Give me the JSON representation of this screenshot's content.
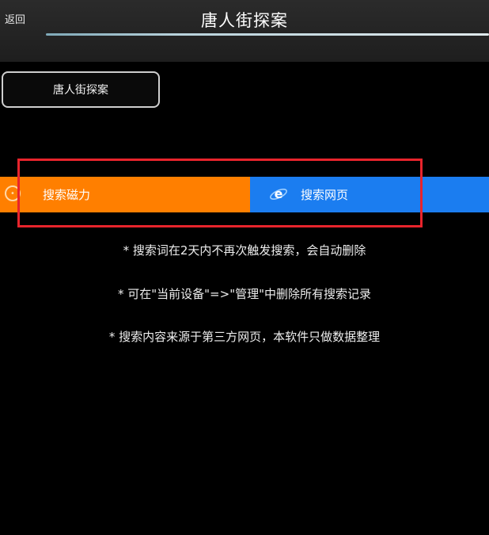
{
  "header": {
    "back_label": "返回",
    "title": "唐人街探案"
  },
  "search": {
    "keyword": "唐人街探案"
  },
  "tabs": [
    {
      "label": "搜索磁力",
      "color": "#ff7f00"
    },
    {
      "label": "搜索网页",
      "color": "#1b7df0"
    }
  ],
  "notes": [
    "* 搜索词在2天内不再次触发搜索，会自动删除",
    "* 可在\"当前设备\"=>\"管理\"中删除所有搜索记录",
    "* 搜索内容来源于第三方网页，本软件只做数据整理"
  ],
  "colors": {
    "background": "#000000",
    "highlight": "#e8242c"
  },
  "icons": {
    "magnet_tab": "magnet-icon",
    "web_tab": "browser-e-icon"
  }
}
